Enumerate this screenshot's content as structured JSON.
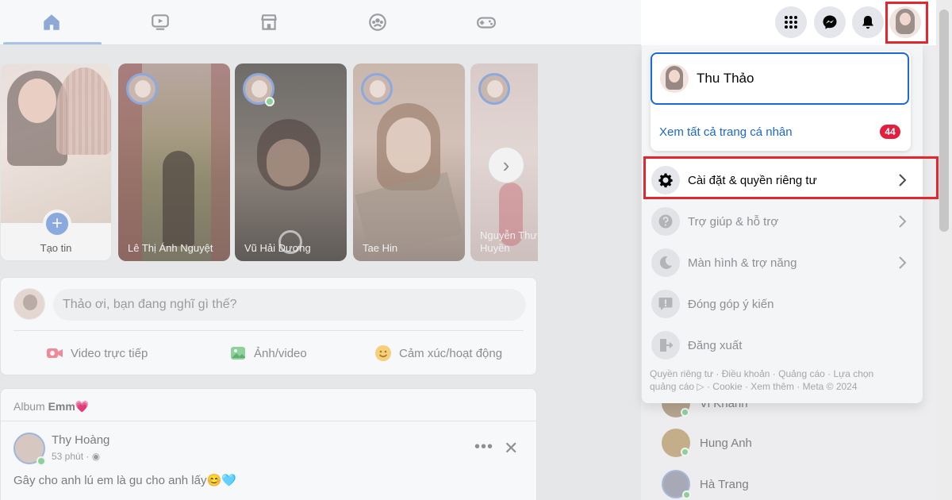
{
  "nav": {
    "tabs": [
      {
        "name": "home",
        "active": true
      },
      {
        "name": "watch"
      },
      {
        "name": "marketplace"
      },
      {
        "name": "groups"
      },
      {
        "name": "gaming"
      }
    ]
  },
  "stories": {
    "create_label": "Tạo tin",
    "items": [
      {
        "name": "Lê Thị Ánh Nguyệt"
      },
      {
        "name": "Vũ Hải Dương"
      },
      {
        "name": "Tae Hin"
      },
      {
        "name": "Nguyễn Thư Huyền"
      }
    ]
  },
  "composer": {
    "placeholder": "Thảo ơi, bạn đang nghĩ gì thế?",
    "live_video": "Video trực tiếp",
    "photo_video": "Ảnh/video",
    "feeling": "Cảm xúc/hoạt động"
  },
  "post": {
    "album_prefix": "Album",
    "album_name": "Emm💗",
    "author": "Thy Hoàng",
    "time": "53 phút ·",
    "body": "Gây cho anh lú em là gu cho anh lấy😊🩵"
  },
  "contacts": [
    {
      "name": "Vi Khánh"
    },
    {
      "name": "Hung Anh"
    },
    {
      "name": "Hà Trang"
    }
  ],
  "dropdown": {
    "profile_name": "Thu Thảo",
    "see_all_profiles": "Xem tất cả trang cá nhân",
    "badge_count": "44",
    "menu": [
      {
        "label": "Cài đặt & quyền riêng tư",
        "icon": "gear-icon",
        "has_chevron": true,
        "highlighted": true
      },
      {
        "label": "Trợ giúp & hỗ trợ",
        "icon": "help-icon",
        "has_chevron": true
      },
      {
        "label": "Màn hình & trợ năng",
        "icon": "moon-icon",
        "has_chevron": true
      },
      {
        "label": "Đóng góp ý kiến",
        "icon": "feedback-icon",
        "has_chevron": false
      },
      {
        "label": "Đăng xuất",
        "icon": "logout-icon",
        "has_chevron": false
      }
    ],
    "footer": "Quyền riêng tư · Điều khoản · Quảng cáo · Lựa chọn quảng cáo ▷ · Cookie · Xem thêm · Meta © 2024"
  },
  "colors": {
    "accent": "#1b67d2",
    "highlight": "#e5262d",
    "badge": "#e41e3f",
    "online": "#8bd19a"
  }
}
